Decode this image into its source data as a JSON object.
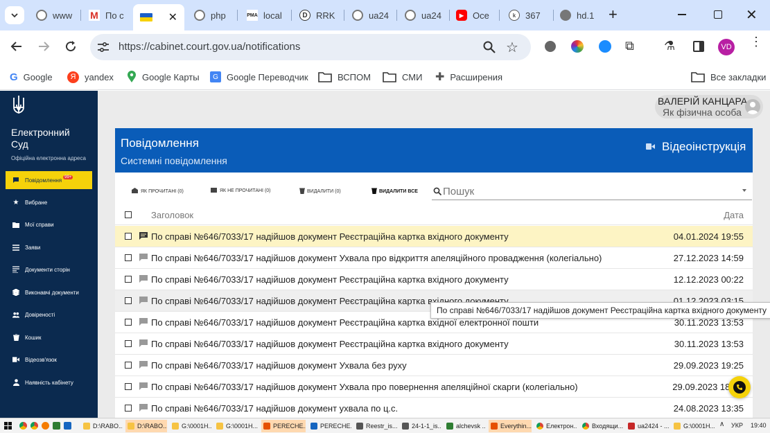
{
  "browser": {
    "tabs": [
      {
        "label": "www"
      },
      {
        "label": "По с"
      },
      {
        "label": ""
      },
      {
        "label": "php"
      },
      {
        "label": "local"
      },
      {
        "label": "RRK"
      },
      {
        "label": "ua24"
      },
      {
        "label": "ua24"
      },
      {
        "label": "Осе"
      },
      {
        "label": "367"
      },
      {
        "label": "hd.1"
      }
    ],
    "new_tab_symbol": "+",
    "url": "https://cabinet.court.gov.ua/notifications",
    "profile_initials": "VD",
    "bookmarks": [
      {
        "label": "Google",
        "icon": "google-icon"
      },
      {
        "label": "yandex",
        "icon": "yandex-icon"
      },
      {
        "label": "Google Карты",
        "icon": "maps-pin-icon"
      },
      {
        "label": "Google Переводчик",
        "icon": "translate-icon"
      },
      {
        "label": "ВСПОМ",
        "icon": "folder-icon"
      },
      {
        "label": "СМИ",
        "icon": "folder-icon"
      },
      {
        "label": "Расширения",
        "icon": "puzzle-icon"
      }
    ],
    "all_bookmarks": "Все закладки"
  },
  "app": {
    "brand_line1": "Електронний",
    "brand_line2": "Суд",
    "brand_sub": "Офіційна електронна адреса",
    "user_name": "ВАЛЕРІЙ КАНЦАРА",
    "user_role": "Як фізична особа",
    "nav": [
      {
        "label": "Повідомлення",
        "badge": "99+",
        "icon": "message-icon",
        "active": true
      },
      {
        "label": "Вибране",
        "icon": "star-icon"
      },
      {
        "label": "Мої справи",
        "icon": "folder-icon"
      },
      {
        "label": "Заяви",
        "icon": "list-icon"
      },
      {
        "label": "Документи сторін",
        "icon": "documents-icon"
      },
      {
        "label": "Виконавчі документи",
        "icon": "layers-icon"
      },
      {
        "label": "Довіреності",
        "icon": "people-icon"
      },
      {
        "label": "Кошик",
        "icon": "trash-icon"
      },
      {
        "label": "Відеозв'язок",
        "icon": "video-icon"
      },
      {
        "label": "Наявність кабінету",
        "icon": "person-icon"
      }
    ]
  },
  "page": {
    "title": "Повідомлення",
    "subtitle": "Системні повідомлення",
    "video_link": "Відеоінструкція",
    "actions": {
      "read": "ЯК ПРОЧИТАНІ (0)",
      "unread": "ЯК НЕ ПРОЧИТАНІ (0)",
      "delete": "ВИДАЛИТИ (0)",
      "delete_all": "ВИДАЛИТИ ВСЕ"
    },
    "search_placeholder": "Пошук",
    "columns": {
      "subject": "Заголовок",
      "date": "Дата"
    },
    "rows": [
      {
        "subject": "По справі №646/7033/17 надійшов документ Реєстраційна картка вхідного документу",
        "date": "04.01.2024 19:55"
      },
      {
        "subject": "По справі №646/7033/17 надійшов документ Ухвала про відкриття апеляційного провадження (колегіально)",
        "date": "27.12.2023 14:59"
      },
      {
        "subject": "По справі №646/7033/17 надійшов документ Реєстраційна картка вхідного документу",
        "date": "12.12.2023 00:22"
      },
      {
        "subject": "По справі №646/7033/17 надійшов документ Реєстраційна картка вхідного документу",
        "date": "01.12.2023 03:15"
      },
      {
        "subject": "По справі №646/7033/17 надійшов документ Реєстраційна картка вхідної електронної пошти",
        "date": "30.11.2023 13:53"
      },
      {
        "subject": "По справі №646/7033/17 надійшов документ Реєстраційна картка вхідного документу",
        "date": "30.11.2023 13:53"
      },
      {
        "subject": "По справі №646/7033/17 надійшов документ Ухвала без руху",
        "date": "29.09.2023 19:25"
      },
      {
        "subject": "По справі №646/7033/17 надійшов документ Ухвала про повернення апеляційної скарги (колегіально)",
        "date": "29.09.2023 18:"
      },
      {
        "subject": "По справі №646/7033/17 надійшов документ ухвала по ц.с.",
        "date": "24.08.2023 13:35"
      }
    ],
    "tooltip": "По справі №646/7033/17 надійшов документ Реєстраційна картка вхідного документу"
  },
  "taskbar": {
    "items": [
      {
        "label": "D:\\RABO..."
      },
      {
        "label": "D:\\RABO..."
      },
      {
        "label": "G:\\0001H..."
      },
      {
        "label": "G:\\0001H..."
      },
      {
        "label": "PERECHE..."
      },
      {
        "label": "PERECHE..."
      },
      {
        "label": "Reestr_is..."
      },
      {
        "label": "24-1-1_is..."
      },
      {
        "label": "alchevsk ..."
      },
      {
        "label": "Everythin..."
      },
      {
        "label": "Електрон..."
      },
      {
        "label": "Входящи..."
      },
      {
        "label": "ua2424 - ..."
      },
      {
        "label": "G:\\0001H..."
      }
    ],
    "lang": "УКР",
    "time": "19:40"
  },
  "colors": {
    "tabbar": "#d3e3fd",
    "sidebar": "#0b2a4f",
    "banner": "#0a5cb8",
    "active_nav": "#f5d20a",
    "highlight_row": "#fdf4c4",
    "hover_row": "#efefef",
    "badge": "#e53935",
    "call_button": "#f5d20a"
  }
}
